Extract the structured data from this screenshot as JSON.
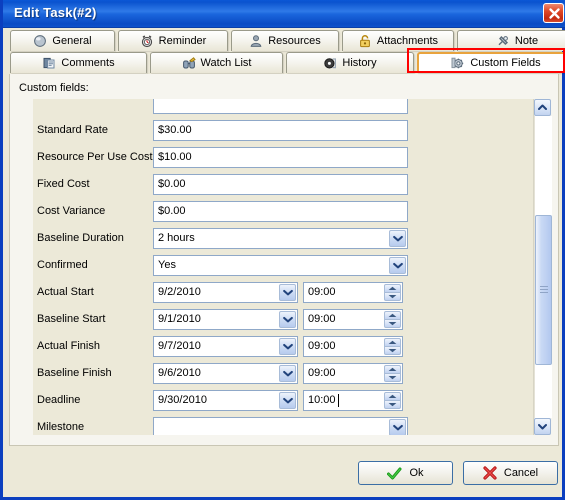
{
  "window": {
    "title": "Edit Task(#2)",
    "close_icon": "close-icon",
    "accent_titlebar": "#0b57d6",
    "panel_background": "#ece9d8",
    "annotation_color": "#ff0000"
  },
  "tabs": {
    "row1": [
      {
        "label": "General",
        "icon": "sphere-icon",
        "active": false
      },
      {
        "label": "Reminder",
        "icon": "alarm-clock-icon",
        "active": false
      },
      {
        "label": "Resources",
        "icon": "person-icon",
        "active": false
      },
      {
        "label": "Attachments",
        "icon": "padlock-icon",
        "active": false
      },
      {
        "label": "Note",
        "icon": "pushpin-icon",
        "active": false
      }
    ],
    "row2": [
      {
        "label": "Comments",
        "icon": "notes-icon",
        "active": false
      },
      {
        "label": "Watch List",
        "icon": "binoculars-icon",
        "active": false
      },
      {
        "label": "History",
        "icon": "clock-icon",
        "active": false
      },
      {
        "label": "Custom Fields",
        "icon": "gear-icon",
        "active": true
      }
    ]
  },
  "main": {
    "caption": "Custom fields:",
    "fields": [
      {
        "label": "",
        "type": "text",
        "value": "",
        "partial": true
      },
      {
        "label": "Standard Rate",
        "type": "text",
        "value": "$30.00"
      },
      {
        "label": "Resource Per Use Cost",
        "type": "text",
        "value": "$10.00"
      },
      {
        "label": "Fixed Cost",
        "type": "text",
        "value": "$0.00"
      },
      {
        "label": "Cost Variance",
        "type": "text",
        "value": "$0.00"
      },
      {
        "label": "Baseline Duration",
        "type": "combo",
        "value": "2 hours"
      },
      {
        "label": "Confirmed",
        "type": "combo",
        "value": "Yes"
      },
      {
        "label": "Actual Start",
        "type": "datetime",
        "value": "9/2/2010",
        "time": "09:00"
      },
      {
        "label": "Baseline Start",
        "type": "datetime",
        "value": "9/1/2010",
        "time": "09:00"
      },
      {
        "label": "Actual Finish",
        "type": "datetime",
        "value": "9/7/2010",
        "time": "09:00"
      },
      {
        "label": "Baseline Finish",
        "type": "datetime",
        "value": "9/6/2010",
        "time": "09:00"
      },
      {
        "label": "Deadline",
        "type": "datetime",
        "value": "9/30/2010",
        "time": "10:00",
        "focused": true
      },
      {
        "label": "Milestone",
        "type": "combo",
        "value": ""
      }
    ]
  },
  "scrollbar": {
    "up_icon": "chevron-up-icon",
    "down_icon": "chevron-down-icon",
    "thumb_position_percent": 65
  },
  "footer": {
    "ok_label": "Ok",
    "ok_icon": "check-icon",
    "cancel_label": "Cancel",
    "cancel_icon": "cross-icon"
  }
}
